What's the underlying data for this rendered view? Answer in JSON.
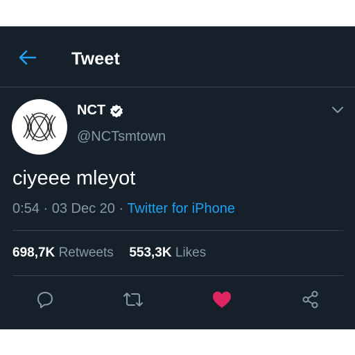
{
  "header": {
    "title": "Tweet"
  },
  "tweet": {
    "author_name": "NCT",
    "author_handle": "@NCTsmtown",
    "text": "ciyeee mleyot",
    "time": "0:54",
    "date": "03 Dec 20",
    "source": "Twitter for iPhone",
    "retweets_count": "698,7K",
    "retweets_label": "Retweets",
    "likes_count": "553,3K",
    "likes_label": "Likes",
    "liked": true
  },
  "icons": {
    "back": "arrow-left-icon",
    "verified": "verified-badge-icon",
    "more": "chevron-down-icon",
    "reply": "reply-icon",
    "retweet": "retweet-icon",
    "like": "heart-icon",
    "share": "share-icon"
  },
  "colors": {
    "background": "#15202b",
    "accent": "#1da1f2",
    "like": "#e0245e",
    "muted": "#8899a6"
  }
}
